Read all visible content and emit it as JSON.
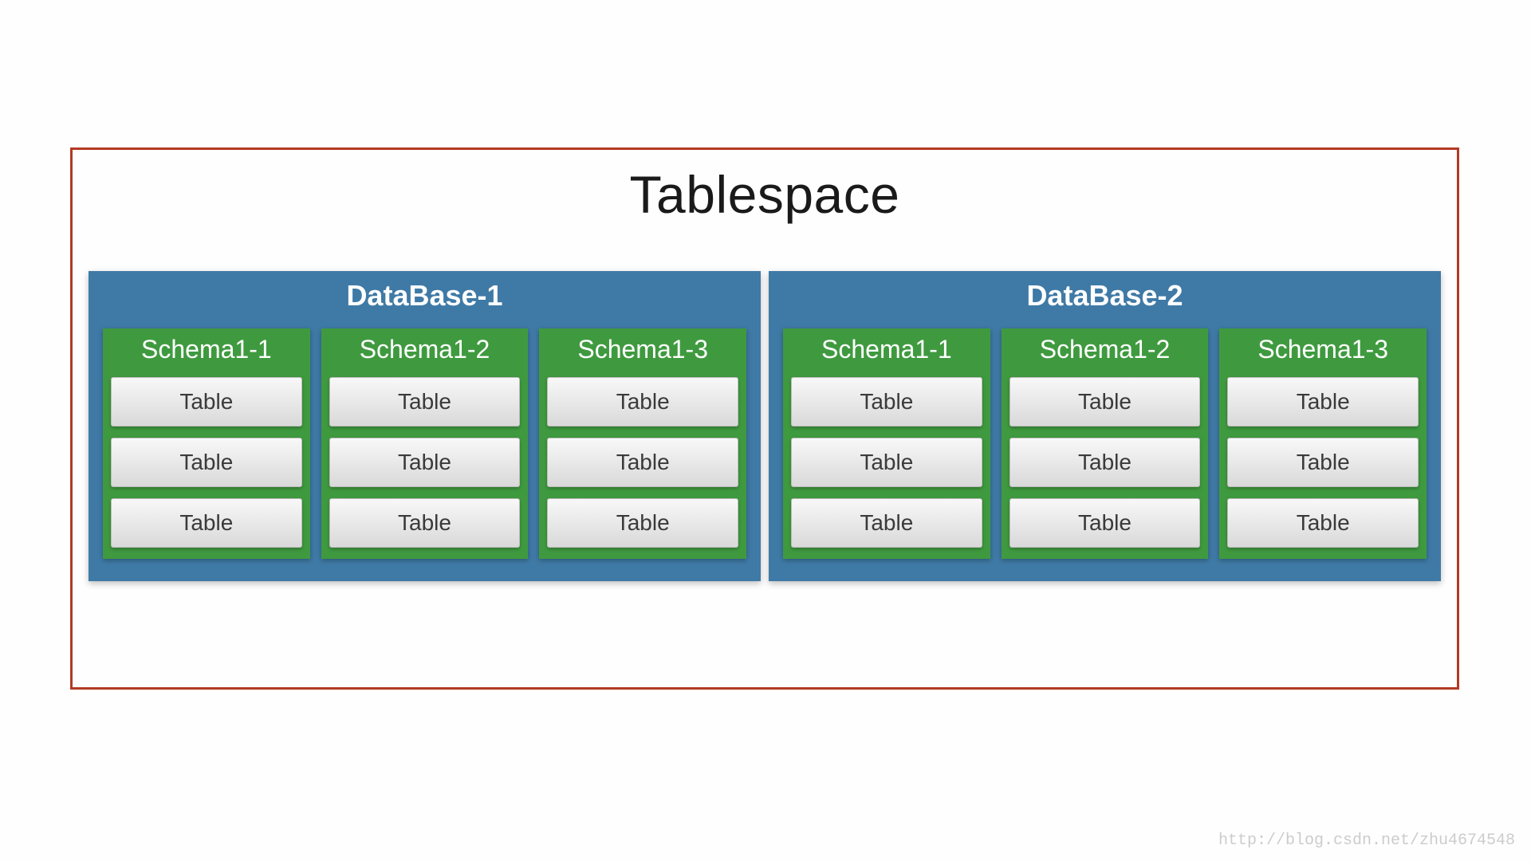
{
  "title": "Tablespace",
  "databases": [
    {
      "name": "DataBase-1",
      "schemas": [
        {
          "name": "Schema1-1",
          "tables": [
            "Table",
            "Table",
            "Table"
          ]
        },
        {
          "name": "Schema1-2",
          "tables": [
            "Table",
            "Table",
            "Table"
          ]
        },
        {
          "name": "Schema1-3",
          "tables": [
            "Table",
            "Table",
            "Table"
          ]
        }
      ]
    },
    {
      "name": "DataBase-2",
      "schemas": [
        {
          "name": "Schema1-1",
          "tables": [
            "Table",
            "Table",
            "Table"
          ]
        },
        {
          "name": "Schema1-2",
          "tables": [
            "Table",
            "Table",
            "Table"
          ]
        },
        {
          "name": "Schema1-3",
          "tables": [
            "Table",
            "Table",
            "Table"
          ]
        }
      ]
    }
  ],
  "watermark": "http://blog.csdn.net/zhu4674548"
}
